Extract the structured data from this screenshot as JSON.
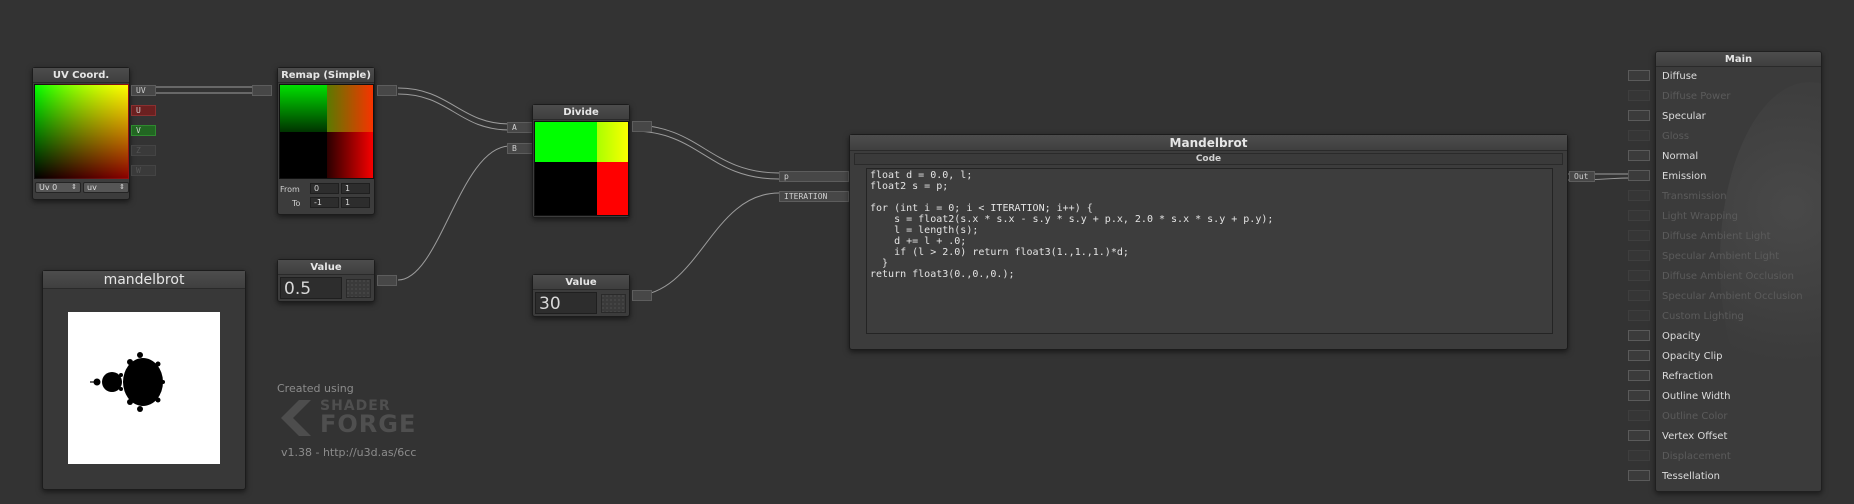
{
  "nodes": {
    "uv_coord": {
      "title": "UV Coord.",
      "outputs": [
        "UV",
        "U",
        "V",
        "Z",
        "W"
      ],
      "uv_channel": "Uv 0",
      "mode": "uv"
    },
    "remap": {
      "title": "Remap (Simple)",
      "from_label": "From",
      "from_min": "0",
      "from_max": "1",
      "to_label": "To",
      "to_min": "-1",
      "to_max": "1"
    },
    "divide": {
      "title": "Divide",
      "input_a": "A",
      "input_b": "B"
    },
    "value_a": {
      "title": "Value",
      "value": "0.5"
    },
    "value_b": {
      "title": "Value",
      "value": "30"
    },
    "mandelbrot": {
      "title": "Mandelbrot",
      "code_label": "Code",
      "input_p": "p",
      "input_iteration": "ITERATION",
      "output": "Out",
      "code_lines": [
        "float d = 0.0, l;",
        "float2 s = p;",
        "",
        "for (int i = 0; i < ITERATION; i++) {",
        "    s = float2(s.x * s.x - s.y * s.y + p.x, 2.0 * s.x * s.y + p.y);",
        "    l = length(s);",
        "    d += l + .0;",
        "    if (l > 2.0) return float3(1.,1.,1.)*d;",
        "  }",
        "return float3(0.,0.,0.);"
      ]
    }
  },
  "preview_panel": {
    "title": "mandelbrot"
  },
  "watermark": {
    "created_using": "Created using",
    "logo_line1": "SHADER",
    "logo_line2": "FORGE",
    "version": "v1.38 - http://u3d.as/6cc"
  },
  "main_node": {
    "title": "Main",
    "inputs": [
      {
        "label": "Diffuse",
        "enabled": true
      },
      {
        "label": "Diffuse Power",
        "enabled": false
      },
      {
        "label": "Specular",
        "enabled": true
      },
      {
        "label": "Gloss",
        "enabled": false
      },
      {
        "label": "Normal",
        "enabled": true
      },
      {
        "label": "Emission",
        "enabled": true
      },
      {
        "label": "Transmission",
        "enabled": false
      },
      {
        "label": "Light Wrapping",
        "enabled": false
      },
      {
        "label": "Diffuse Ambient Light",
        "enabled": false
      },
      {
        "label": "Specular Ambient Light",
        "enabled": false
      },
      {
        "label": "Diffuse Ambient Occlusion",
        "enabled": false
      },
      {
        "label": "Specular Ambient Occlusion",
        "enabled": false
      },
      {
        "label": "Custom Lighting",
        "enabled": false
      },
      {
        "label": "Opacity",
        "enabled": true
      },
      {
        "label": "Opacity Clip",
        "enabled": true
      },
      {
        "label": "Refraction",
        "enabled": true
      },
      {
        "label": "Outline Width",
        "enabled": true
      },
      {
        "label": "Outline Color",
        "enabled": false
      },
      {
        "label": "Vertex Offset",
        "enabled": true
      },
      {
        "label": "Displacement",
        "enabled": false
      },
      {
        "label": "Tessellation",
        "enabled": true
      }
    ]
  },
  "colors": {
    "canvas": "#333333",
    "node": "#3c3c3c",
    "wire": "#aaaaaa",
    "port_red": "#6b2020",
    "port_green": "#226622"
  }
}
